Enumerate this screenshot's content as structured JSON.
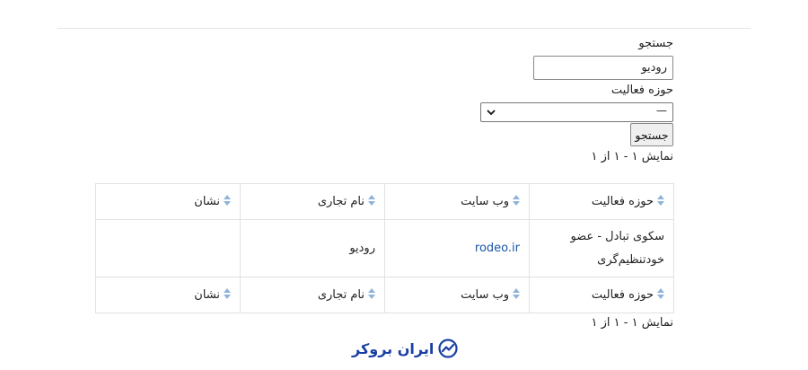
{
  "search": {
    "label": "جستجو",
    "value": "رودیو"
  },
  "field": {
    "label": "حوزه فعالیت",
    "selected": "—"
  },
  "search_button": "جستجو",
  "results_top": "نمایش ۱ - ۱ از ۱",
  "results_bottom": "نمایش ۱ - ۱ از ۱",
  "table": {
    "headers": [
      "حوزه فعالیت",
      "وب سایت",
      "نام تجاری",
      "نشان"
    ],
    "rows": [
      {
        "field_line1": "سکوی تبادل - عضو",
        "field_line2": "خودتنظیم‌گری",
        "website": "rodeo.ir",
        "brand": "رودیو",
        "logo": ""
      }
    ]
  },
  "footer_brand": "ایران بروکر",
  "colors": {
    "link": "#1a55a5",
    "brand": "#1a3fa4",
    "sort_icon": "#8fb3d9"
  }
}
